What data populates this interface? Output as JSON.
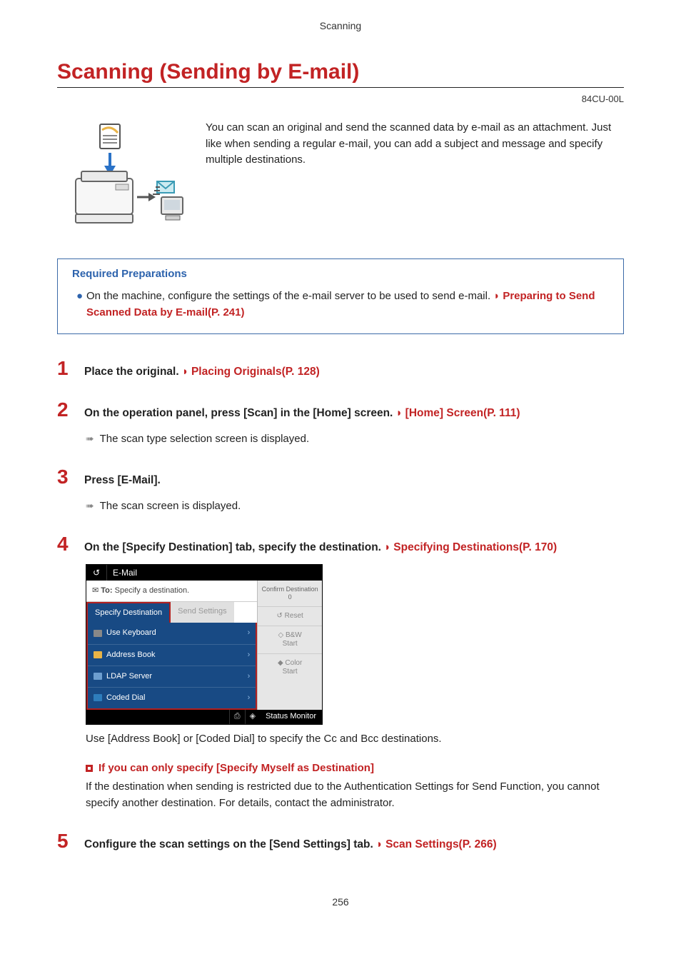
{
  "chapter": "Scanning",
  "page_title": "Scanning (Sending by E-mail)",
  "doc_id": "84CU-00L",
  "intro": "You can scan an original and send the scanned data by e-mail as an attachment. Just like when sending a regular e-mail, you can add a subject and message and specify multiple destinations.",
  "prep": {
    "title": "Required Preparations",
    "item_text": "On the machine, configure the settings of the e-mail server to be used to send e-mail. ",
    "item_link": "Preparing to Send Scanned Data by E-mail(P. 241)"
  },
  "steps": [
    {
      "num": "1",
      "title_pre": "Place the original. ",
      "title_link": "Placing Originals(P. 128)"
    },
    {
      "num": "2",
      "title_pre": "On the operation panel, press [Scan] in the [Home] screen. ",
      "title_link": "[Home] Screen(P. 111)",
      "result": "The scan type selection screen is displayed."
    },
    {
      "num": "3",
      "title_pre": "Press [E-Mail].",
      "title_link": "",
      "result": "The scan screen is displayed."
    },
    {
      "num": "4",
      "title_pre": "On the [Specify Destination] tab, specify the destination. ",
      "title_link": "Specifying Destinations(P. 170)",
      "after_panel": "Use [Address Book] or [Coded Dial] to specify the Cc and Bcc destinations.",
      "sub_title": "If you can only specify [Specify Myself as Destination]",
      "sub_body": "If the destination when sending is restricted due to the Authentication Settings for Send Function, you cannot specify another destination. For details, contact the administrator."
    },
    {
      "num": "5",
      "title_pre": "Configure the scan settings on the [Send Settings] tab. ",
      "title_link": "Scan Settings(P. 266)"
    }
  ],
  "panel": {
    "title": "E-Mail",
    "to_label": "To:",
    "to_placeholder": "Specify a destination.",
    "tab_active": "Specify Destination",
    "tab_other": "Send Settings",
    "items": [
      "Use Keyboard",
      "Address Book",
      "LDAP Server",
      "Coded Dial"
    ],
    "confirm": "Confirm Destination",
    "confirm_count": "0",
    "reset": "Reset",
    "bw": "B&W\nStart",
    "color": "Color\nStart",
    "status": "Status Monitor"
  },
  "page_number": "256"
}
